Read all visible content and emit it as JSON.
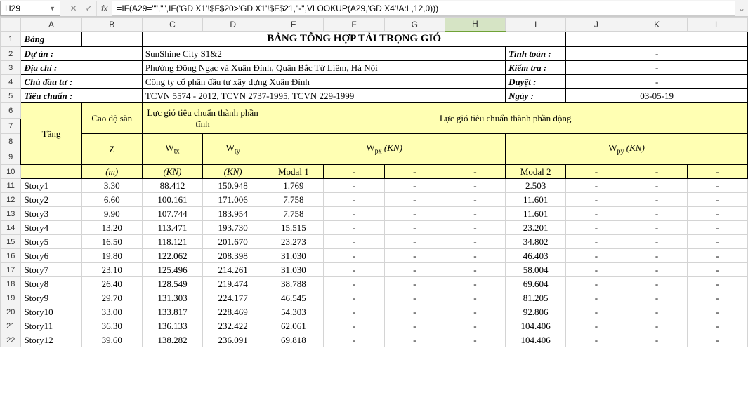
{
  "name_box": "H29",
  "formula": "=IF(A29=\"\",\"\",IF('GD X1'!$F$20>'GD X1'!$F$21,\"-\",VLOOKUP(A29,'GD X4'!A:L,12,0)))",
  "col_labels": [
    "A",
    "B",
    "C",
    "D",
    "E",
    "F",
    "G",
    "H",
    "I",
    "J",
    "K",
    "L"
  ],
  "active_col": "H",
  "labels": {
    "bang": "Bảng",
    "duan": "Dự án :",
    "diachi": "Địa chỉ :",
    "chudautu": "Chủ đầu tư :",
    "tieuchuan": "Tiêu chuẩn :",
    "tinhtoan": "Tính toán :",
    "kiemtra": "Kiểm tra :",
    "duyet": "Duyệt :",
    "ngay": "Ngày :"
  },
  "title": "BẢNG TỔNG HỢP TẢI TRỌNG GIÓ",
  "project": "SunShine City S1&2",
  "address": "Phường Đông Ngạc và Xuân Đỉnh, Quận Bắc Từ Liêm, Hà Nội",
  "owner": "Công ty cổ phần đầu tư xây dựng Xuân Đỉnh",
  "standard": "TCVN 5574 - 2012, TCVN 2737-1995, TCVN 229-1999",
  "tinhtoan_val": "-",
  "kiemtra_val": "-",
  "duyet_val": "-",
  "date": "03-05-19",
  "headers": {
    "tang": "Tầng",
    "caodosan": "Cao độ sàn",
    "lucgio_tinh": "Lực gió tiêu chuẩn thành phần tĩnh",
    "lucgio_dong": "Lực gió tiêu chuẩn thành phần động",
    "Z": "Z",
    "Wtx_pre": "W",
    "Wtx_sub": "tx",
    "Wty_pre": "W",
    "Wty_sub": "ty",
    "Wpx_pre": "W",
    "Wpx_sub": "px",
    "Wpx_unit": " (KN)",
    "Wpy_pre": "W",
    "Wpy_sub": "py",
    "Wpy_unit": " (KN)",
    "m": "(m)",
    "KN": "(KN)",
    "modal1": "Modal 1",
    "modal2": "Modal 2",
    "dash": "-"
  },
  "rows": [
    {
      "n": 11,
      "story": "Story1",
      "z": "3.30",
      "wtx": "88.412",
      "wty": "150.948",
      "m1": "1.769",
      "m2": "2.503"
    },
    {
      "n": 12,
      "story": "Story2",
      "z": "6.60",
      "wtx": "100.161",
      "wty": "171.006",
      "m1": "7.758",
      "m2": "11.601"
    },
    {
      "n": 13,
      "story": "Story3",
      "z": "9.90",
      "wtx": "107.744",
      "wty": "183.954",
      "m1": "7.758",
      "m2": "11.601"
    },
    {
      "n": 14,
      "story": "Story4",
      "z": "13.20",
      "wtx": "113.471",
      "wty": "193.730",
      "m1": "15.515",
      "m2": "23.201"
    },
    {
      "n": 15,
      "story": "Story5",
      "z": "16.50",
      "wtx": "118.121",
      "wty": "201.670",
      "m1": "23.273",
      "m2": "34.802"
    },
    {
      "n": 16,
      "story": "Story6",
      "z": "19.80",
      "wtx": "122.062",
      "wty": "208.398",
      "m1": "31.030",
      "m2": "46.403"
    },
    {
      "n": 17,
      "story": "Story7",
      "z": "23.10",
      "wtx": "125.496",
      "wty": "214.261",
      "m1": "31.030",
      "m2": "58.004"
    },
    {
      "n": 18,
      "story": "Story8",
      "z": "26.40",
      "wtx": "128.549",
      "wty": "219.474",
      "m1": "38.788",
      "m2": "69.604"
    },
    {
      "n": 19,
      "story": "Story9",
      "z": "29.70",
      "wtx": "131.303",
      "wty": "224.177",
      "m1": "46.545",
      "m2": "81.205"
    },
    {
      "n": 20,
      "story": "Story10",
      "z": "33.00",
      "wtx": "133.817",
      "wty": "228.469",
      "m1": "54.303",
      "m2": "92.806"
    },
    {
      "n": 21,
      "story": "Story11",
      "z": "36.30",
      "wtx": "136.133",
      "wty": "232.422",
      "m1": "62.061",
      "m2": "104.406"
    },
    {
      "n": 22,
      "story": "Story12",
      "z": "39.60",
      "wtx": "138.282",
      "wty": "236.091",
      "m1": "69.818",
      "m2": "104.406"
    }
  ]
}
